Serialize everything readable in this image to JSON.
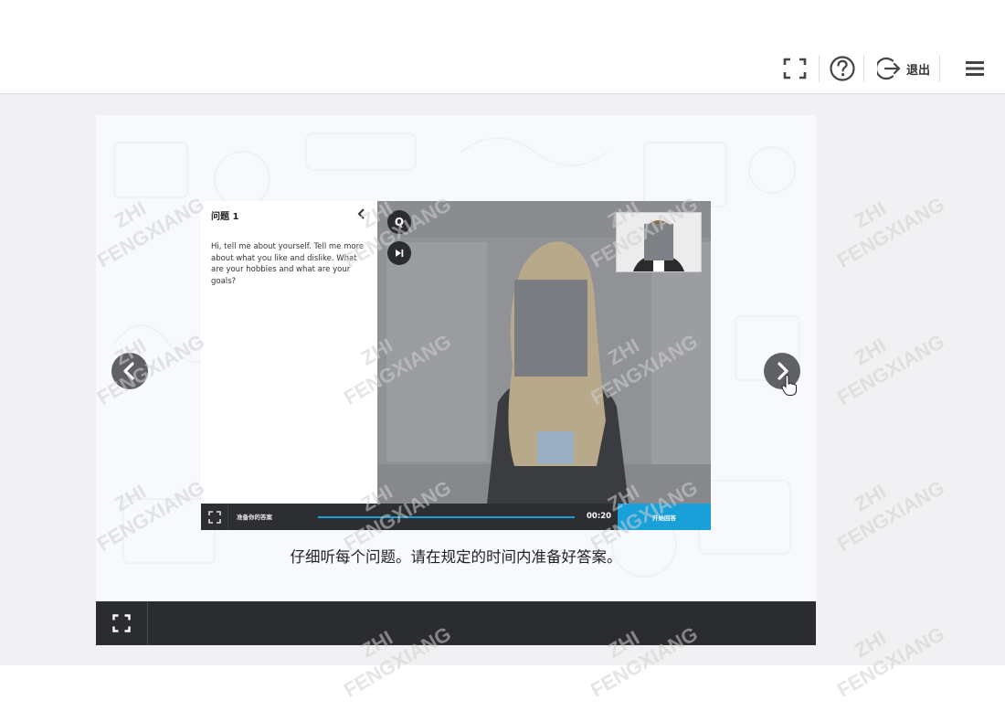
{
  "header": {
    "exit_label": "退出",
    "icons": [
      "fullscreen-icon",
      "help-icon",
      "exit-icon",
      "menu-icon"
    ]
  },
  "question": {
    "title": "问题 1",
    "text": "Hi, tell me about yourself. Tell me more about what you like and dislike. What are your hobbies and what are your goals?"
  },
  "player": {
    "q_button_label": "Q",
    "prepare_label": "准备你的答案",
    "timer": "00:20",
    "start_label": "开始回答"
  },
  "caption": "仔细听每个问题。请在规定的时间内准备好答案。",
  "watermark": {
    "line1": "ZHI",
    "line2": "FENGXIANG"
  },
  "colors": {
    "accent": "#1aa0d8",
    "dark_bar": "#2a2c2f",
    "arrow_bg": "#5f6166"
  }
}
